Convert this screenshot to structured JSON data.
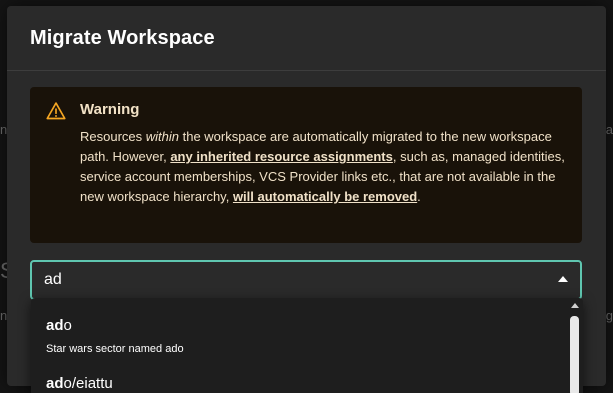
{
  "background": {
    "peek_left_a": "n",
    "peek_left_b": "S",
    "peek_left_c": "n",
    "peek_right_a": "a",
    "peek_right_b": "g"
  },
  "dialog": {
    "title": "Migrate Workspace"
  },
  "alert": {
    "icon": "warning-triangle-icon",
    "title": "Warning",
    "body_part1": "Resources ",
    "body_em": "within",
    "body_part2": " the workspace are automatically migrated to the new workspace path. However, ",
    "body_link1": "any inherited resource assignments",
    "body_part3": ", such as, managed identities, service account memberships, VCS Provider links etc., that are not available in the new workspace hierarchy, ",
    "body_link2": "will automatically be removed",
    "body_part4": ".",
    "accent_color": "#f5a623"
  },
  "search": {
    "value": "ad",
    "border_color": "#5fc6b0"
  },
  "options": [
    {
      "match": "ad",
      "rest": "o",
      "description": "Star wars sector named ado"
    },
    {
      "match": "ad",
      "rest": "o/eiattu",
      "description": ""
    }
  ]
}
